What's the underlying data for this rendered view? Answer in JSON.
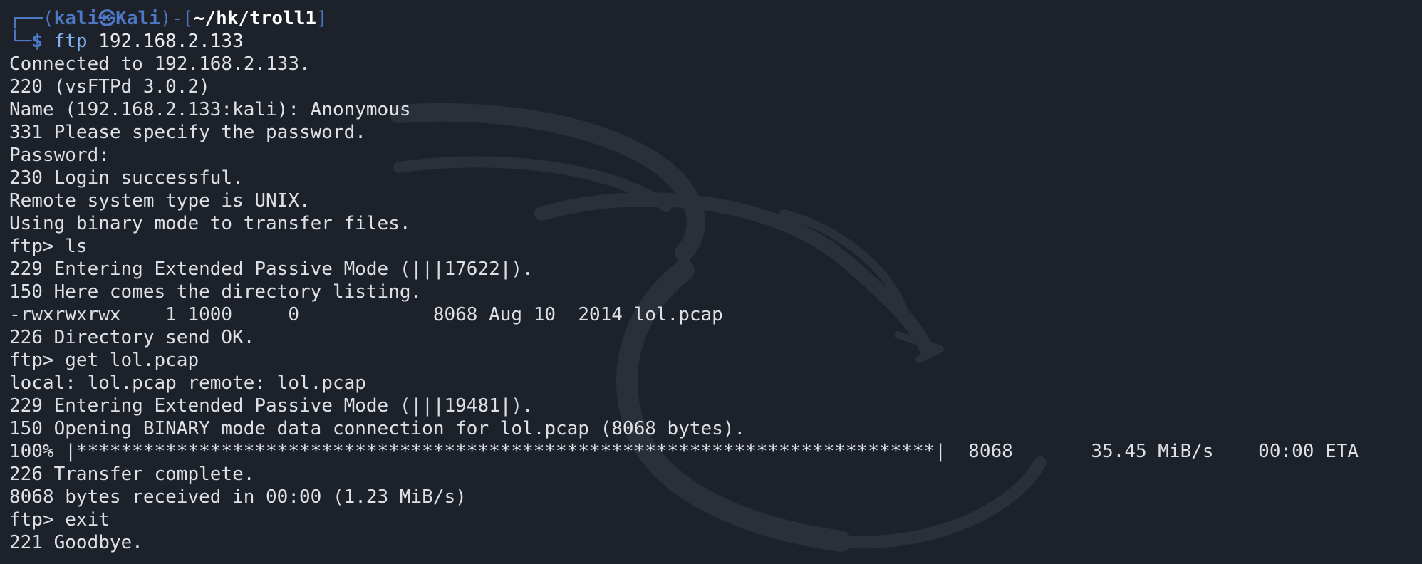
{
  "prompt": {
    "frame_top_left": "┌──(",
    "user": "kali",
    "at_symbol": "㉿",
    "host": "Kali",
    "frame_mid": ")-[",
    "path": "~/hk/troll1",
    "frame_close": "]",
    "frame_bottom": "└─",
    "symbol": "$",
    "command": "ftp",
    "argument": "192.168.2.133"
  },
  "output": [
    "Connected to 192.168.2.133.",
    "220 (vsFTPd 3.0.2)",
    "Name (192.168.2.133:kali): Anonymous",
    "331 Please specify the password.",
    "Password:",
    "230 Login successful.",
    "Remote system type is UNIX.",
    "Using binary mode to transfer files.",
    "ftp> ls",
    "229 Entering Extended Passive Mode (|||17622|).",
    "150 Here comes the directory listing.",
    "-rwxrwxrwx    1 1000     0            8068 Aug 10  2014 lol.pcap",
    "226 Directory send OK.",
    "ftp> get lol.pcap",
    "local: lol.pcap remote: lol.pcap",
    "229 Entering Extended Passive Mode (|||19481|).",
    "150 Opening BINARY mode data connection for lol.pcap (8068 bytes).",
    "100% |*****************************************************************************|  8068       35.45 MiB/s    00:00 ETA",
    "226 Transfer complete.",
    "8068 bytes received in 00:00 (1.23 MiB/s)",
    "ftp> exit",
    "221 Goodbye."
  ],
  "colors": {
    "background": "#1d2129",
    "prompt_accent": "#4d79c7",
    "text": "#dde1e6"
  },
  "icons": {
    "watermark": "kali-dragon-icon"
  }
}
